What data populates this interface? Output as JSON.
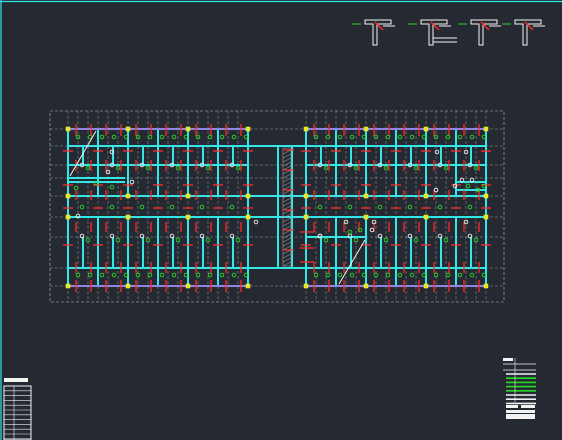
{
  "colors": {
    "background": "#252932",
    "frame": "#2ee6e6",
    "grid": "#b9b9b9",
    "wall": "#35e6e6",
    "rebar": "#ff2a2a",
    "marker": "#27d927",
    "column": "#e6e62a",
    "beam": "#c64be6",
    "white": "#f2f2f2"
  },
  "detail_sections": [
    "section-a",
    "section-b",
    "section-c",
    "section-d"
  ],
  "plan": {
    "left_wing": "left",
    "right_wing": "right",
    "stair_cores": 2
  },
  "title_block": {
    "rows": 11
  },
  "legend": {
    "rows": 8
  }
}
